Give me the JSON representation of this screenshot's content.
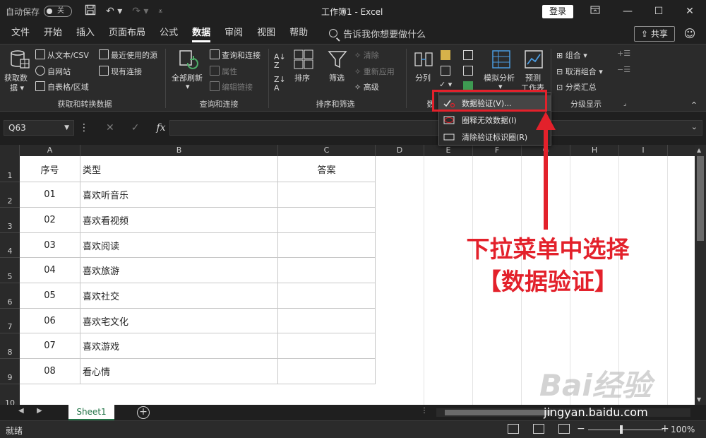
{
  "titlebar": {
    "autosave_label": "自动保存",
    "autosave_state": "关",
    "doc_title": "工作簿1  -  Excel",
    "login_label": "登录"
  },
  "menu": {
    "tabs": [
      "文件",
      "开始",
      "插入",
      "页面布局",
      "公式",
      "数据",
      "审阅",
      "视图",
      "帮助"
    ],
    "active_tab": "数据",
    "tellme_placeholder": "告诉我你想要做什么",
    "share_label": "共享"
  },
  "ribbon": {
    "get_data": {
      "big_label_1": "获取数",
      "big_label_2": "据",
      "from_text": "从文本/CSV",
      "from_web": "自网站",
      "from_table": "自表格/区域",
      "recent_sources": "最近使用的源",
      "existing_conn": "现有连接",
      "group_title": "获取和转换数据"
    },
    "queries": {
      "refresh_all": "全部刷新",
      "queries_conn": "查询和连接",
      "properties": "属性",
      "edit_links": "编辑链接",
      "group_title": "查询和连接"
    },
    "sort_filter": {
      "sort": "排序",
      "filter": "筛选",
      "clear": "清除",
      "reapply": "重新应用",
      "advanced": "高级",
      "group_title": "排序和筛选"
    },
    "data_tools": {
      "split": "分列",
      "group_title": "数"
    },
    "forecast": {
      "what_if": "模拟分析",
      "forecast_sheet_1": "预测",
      "forecast_sheet_2": "工作表"
    },
    "outline": {
      "group": "组合",
      "ungroup": "取消组合",
      "subtotal": "分类汇总",
      "group_title": "分级显示"
    }
  },
  "dropdown": {
    "items": [
      "数据验证(V)...",
      "圈释无效数据(I)",
      "清除验证标识圈(R)"
    ]
  },
  "formula_bar": {
    "name_box": "Q63",
    "fx": "fx"
  },
  "sheet": {
    "columns": [
      "A",
      "B",
      "C",
      "D",
      "E",
      "F",
      "G",
      "H",
      "I"
    ],
    "rows": [
      "1",
      "2",
      "3",
      "4",
      "5",
      "6",
      "7",
      "8",
      "9",
      "10"
    ],
    "header": {
      "a": "序号",
      "b": "类型",
      "c": "答案"
    },
    "data": [
      {
        "a": "01",
        "b": "喜欢听音乐"
      },
      {
        "a": "02",
        "b": "喜欢看视频"
      },
      {
        "a": "03",
        "b": "喜欢阅读"
      },
      {
        "a": "04",
        "b": "喜欢旅游"
      },
      {
        "a": "05",
        "b": "喜欢社交"
      },
      {
        "a": "06",
        "b": "喜欢宅文化"
      },
      {
        "a": "07",
        "b": "喜欢游戏"
      },
      {
        "a": "08",
        "b": "看心情"
      }
    ],
    "tab_name": "Sheet1"
  },
  "status": {
    "ready": "就绪",
    "zoom": "100%"
  },
  "annotation": {
    "line1": "下拉菜单中选择",
    "line2": "【数据验证】",
    "accent": "#e3212b"
  },
  "watermark": {
    "brand": "Bai经验",
    "url": "jingyan.baidu.com"
  }
}
